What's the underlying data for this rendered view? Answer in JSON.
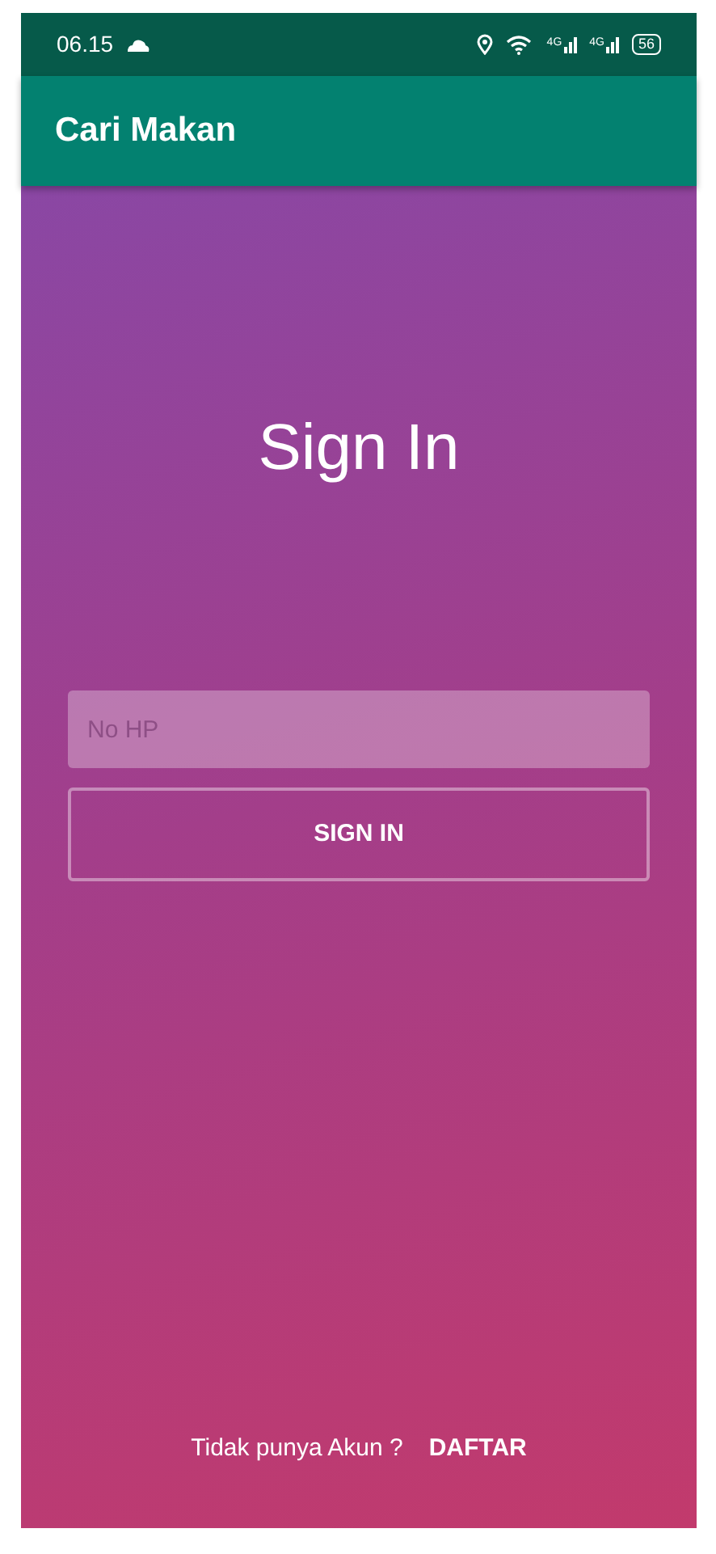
{
  "status_bar": {
    "time": "06.15",
    "network_labels": [
      "4G",
      "4G"
    ],
    "battery": "56"
  },
  "app_bar": {
    "title": "Cari Makan"
  },
  "heading": "Sign In",
  "phone_field": {
    "placeholder": "No HP"
  },
  "sign_in_button": "SIGN IN",
  "footer": {
    "prompt": "Tidak punya Akun ?",
    "register_link": "DAFTAR"
  }
}
